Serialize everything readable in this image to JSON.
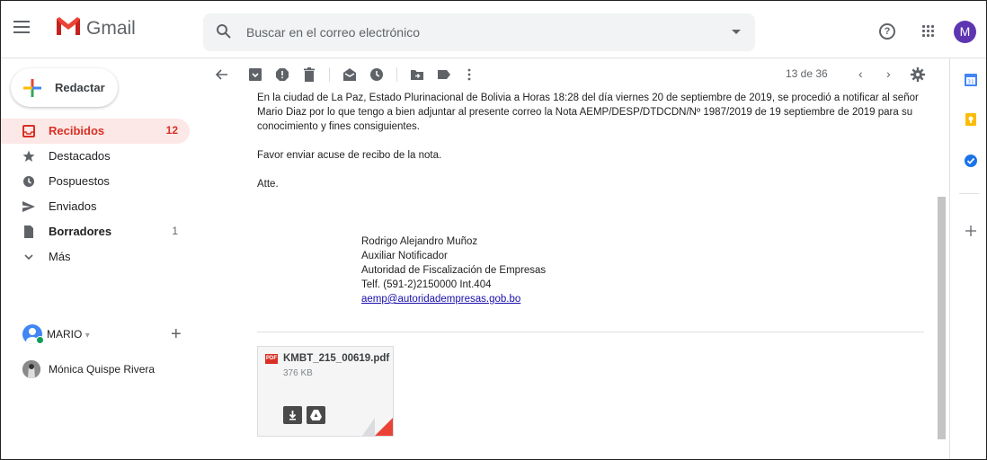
{
  "app": {
    "brand": "Gmail",
    "search_placeholder": "Buscar en el correo electrónico",
    "account_initial": "M",
    "colors": {
      "accent": "#d93025",
      "avatar": "#5e35b1",
      "link": "#1a0dab"
    }
  },
  "sidebar": {
    "compose_label": "Redactar",
    "items": [
      {
        "label": "Recibidos",
        "count": "12",
        "icon": "inbox-icon",
        "active": true
      },
      {
        "label": "Destacados",
        "count": "",
        "icon": "star-icon"
      },
      {
        "label": "Pospuestos",
        "count": "",
        "icon": "clock-icon"
      },
      {
        "label": "Enviados",
        "count": "",
        "icon": "send-icon"
      },
      {
        "label": "Borradores",
        "count": "1",
        "icon": "draft-icon",
        "bold": true
      },
      {
        "label": "Más",
        "count": "",
        "icon": "chevron-down-icon"
      }
    ],
    "hangouts_user": "MARIO",
    "contact": "Mónica Quispe Rivera"
  },
  "toolbar": {
    "pager": "13 de 36"
  },
  "message": {
    "paragraph1": "En la ciudad de La Paz, Estado Plurinacional de Bolivia a Horas 18:28 del día viernes 20 de septiembre de 2019, se procedió a notificar al señor Mario Diaz por lo que tengo a bien adjuntar al presente correo la Nota AEMP/DESP/DTDCDN/Nº 1987/2019  de 19 septiembre de 2019 para su conocimiento y fines consiguientes.",
    "paragraph2": "Favor enviar acuse de recibo de la nota.",
    "closing": "Atte.",
    "signature": {
      "name": "Rodrigo Alejandro Muñoz",
      "role": "Auxiliar Notificador",
      "org": "Autoridad de Fiscalización de Empresas",
      "phone": "Telf. (591-2)2150000 Int.404",
      "email": "aemp@autoridadempresas.gob.bo"
    },
    "attachment": {
      "badge": "PDF",
      "filename": "KMBT_215_00619.pdf",
      "size": "376 KB"
    }
  }
}
